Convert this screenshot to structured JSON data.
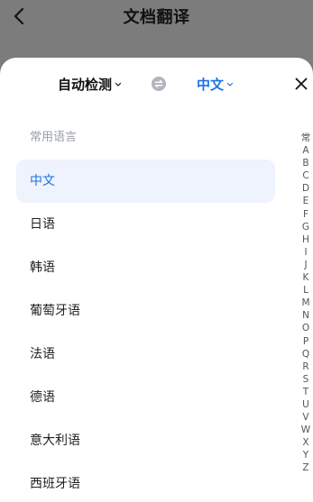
{
  "background_page": {
    "title": "文档翻译",
    "back_icon": "chevron-left-icon"
  },
  "sheet": {
    "source_language": "自动检测",
    "target_language": "中文",
    "swap_icon": "swap-icon",
    "close_icon": "close-icon",
    "section_label": "常用语言",
    "languages": [
      {
        "label": "中文",
        "selected": true
      },
      {
        "label": "日语",
        "selected": false
      },
      {
        "label": "韩语",
        "selected": false
      },
      {
        "label": "葡萄牙语",
        "selected": false
      },
      {
        "label": "法语",
        "selected": false
      },
      {
        "label": "德语",
        "selected": false
      },
      {
        "label": "意大利语",
        "selected": false
      },
      {
        "label": "西班牙语",
        "selected": false
      }
    ],
    "index_letters": [
      "常",
      "A",
      "B",
      "C",
      "D",
      "E",
      "F",
      "G",
      "H",
      "I",
      "J",
      "K",
      "L",
      "M",
      "N",
      "O",
      "P",
      "Q",
      "R",
      "S",
      "T",
      "U",
      "V",
      "W",
      "X",
      "Y",
      "Z"
    ]
  },
  "colors": {
    "accent": "#1a73e8",
    "selected_bg": "#eef3fd",
    "overlay": "#7c7c7c"
  }
}
